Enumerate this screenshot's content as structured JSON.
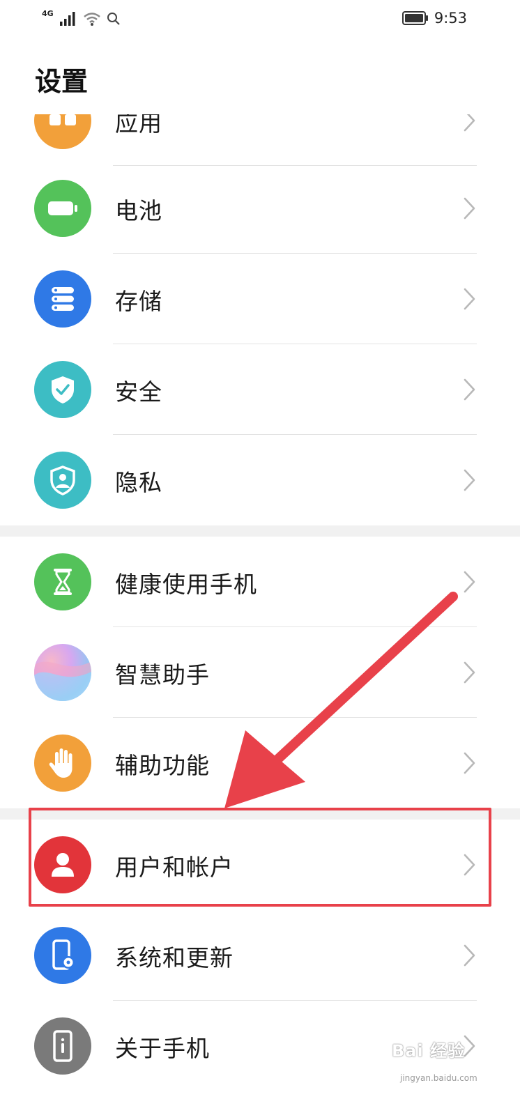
{
  "status_bar": {
    "network": "4G",
    "time": "9:53",
    "icons": [
      "signal-icon",
      "wifi-icon",
      "search-icon",
      "battery-icon"
    ]
  },
  "header": {
    "title": "设置"
  },
  "items": [
    {
      "label": "应用",
      "icon": "apps-icon",
      "color": "#f2a03a"
    },
    {
      "label": "电池",
      "icon": "battery-icon",
      "color": "#54c25a"
    },
    {
      "label": "存储",
      "icon": "storage-icon",
      "color": "#2f79e6"
    },
    {
      "label": "安全",
      "icon": "shield-check-icon",
      "color": "#3dbdc4"
    },
    {
      "label": "隐私",
      "icon": "privacy-shield-icon",
      "color": "#3dbdc4"
    },
    {
      "label": "健康使用手机",
      "icon": "hourglass-icon",
      "color": "#54c25a"
    },
    {
      "label": "智慧助手",
      "icon": "assistant-icon",
      "color": "#b59ee8"
    },
    {
      "label": "辅助功能",
      "icon": "hand-icon",
      "color": "#f2a03a"
    },
    {
      "label": "用户和帐户",
      "icon": "user-icon",
      "color": "#e2343a"
    },
    {
      "label": "系统和更新",
      "icon": "phone-gear-icon",
      "color": "#2f79e6"
    },
    {
      "label": "关于手机",
      "icon": "phone-info-icon",
      "color": "#7a7a7a"
    }
  ],
  "annotation": {
    "highlight_color": "#e8414a"
  },
  "watermark": {
    "text": "Bai 经验",
    "sub": "jingyan.baidu.com"
  }
}
